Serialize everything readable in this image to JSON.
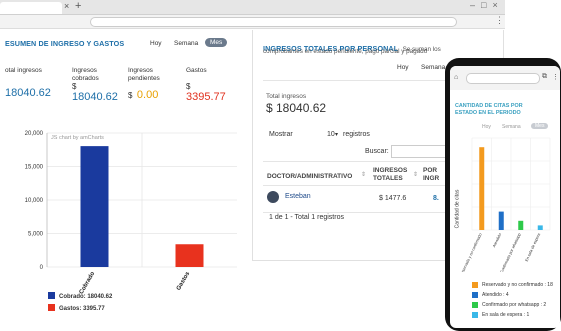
{
  "browser": {
    "tab_close": "×",
    "new_tab": "+",
    "window_controls": "–□×",
    "menu": "⋮"
  },
  "left_card": {
    "title": "ESUMEN DE INGRESO Y GASTOS",
    "periods": [
      "Hoy",
      "Semana",
      "Mes"
    ],
    "active_period": "Mes",
    "metrics": [
      {
        "label_lines": [
          "otal ingresos",
          ""
        ],
        "currency": "",
        "value": "18040.62"
      },
      {
        "label_lines": [
          "Ingresos",
          "cobrados"
        ],
        "currency": "$",
        "value": "18040.62"
      },
      {
        "label_lines": [
          "Ingresos",
          "pendientes"
        ],
        "currency": "$",
        "value": "0.00"
      },
      {
        "label_lines": [
          "Gastos",
          ""
        ],
        "currency": "$",
        "value": "3395.77"
      }
    ]
  },
  "chart_data": {
    "type": "bar",
    "watermark": "JS chart by amCharts",
    "categories": [
      "Cobrado",
      "Gastos"
    ],
    "values": [
      18040.62,
      3395.77
    ],
    "colors": [
      "#1a3a9e",
      "#e8321e"
    ],
    "ylim": [
      0,
      20000
    ],
    "yticks": [
      "20,000",
      "15,000",
      "10,000",
      "5,000",
      "0"
    ],
    "legend": [
      "Cobrado: 18040.62",
      "Gastos: 3395.77"
    ]
  },
  "right_card": {
    "title": "INGRESOS TOTALES POR PERSONAL",
    "subtitle_inline": "Se suman los",
    "subtitle_line2": "comprobantes en estado pendiente, pago parcial y pagado",
    "periods": [
      "Hoy",
      "Semana"
    ],
    "total_label": "Total ingresos",
    "total_value": "$ 18040.62",
    "show_label": "Mostrar",
    "show_value": "10",
    "show_suffix": "registros",
    "search_label": "Buscar:",
    "columns": [
      "DOCTOR/ADMINISTRATIVO",
      "INGRESOS TOTALES",
      "POR INGR"
    ],
    "sort_icon": "⇕",
    "rows": [
      {
        "name": "Esteban",
        "total": "$ 1477.6",
        "partial": "8."
      }
    ],
    "footer": "1 de 1 - Total 1 registros"
  },
  "phone": {
    "chart_title_lines": [
      "CANTIDAD DE CITAS POR",
      "ESTADO EN EL PERIODO"
    ],
    "periods": [
      "Hoy",
      "Semana",
      "Mes"
    ],
    "y_axis_label": "Cantidad de citas",
    "phone_chart": {
      "type": "bar",
      "categories": [
        "Reservado y no confirmado",
        "Atendido",
        "Confirmado por whatsapp",
        "En sala de espera"
      ],
      "values": [
        18,
        4,
        2,
        1
      ],
      "colors": [
        "#f39a1e",
        "#1f6fc7",
        "#2ec94a",
        "#3ab8e8"
      ],
      "ylim": [
        0,
        20
      ]
    },
    "legend": [
      "Reservado y no confirmado : 18",
      "Atendido : 4",
      "Confirmado por whatsapp : 2",
      "En sala de espera : 1"
    ]
  }
}
